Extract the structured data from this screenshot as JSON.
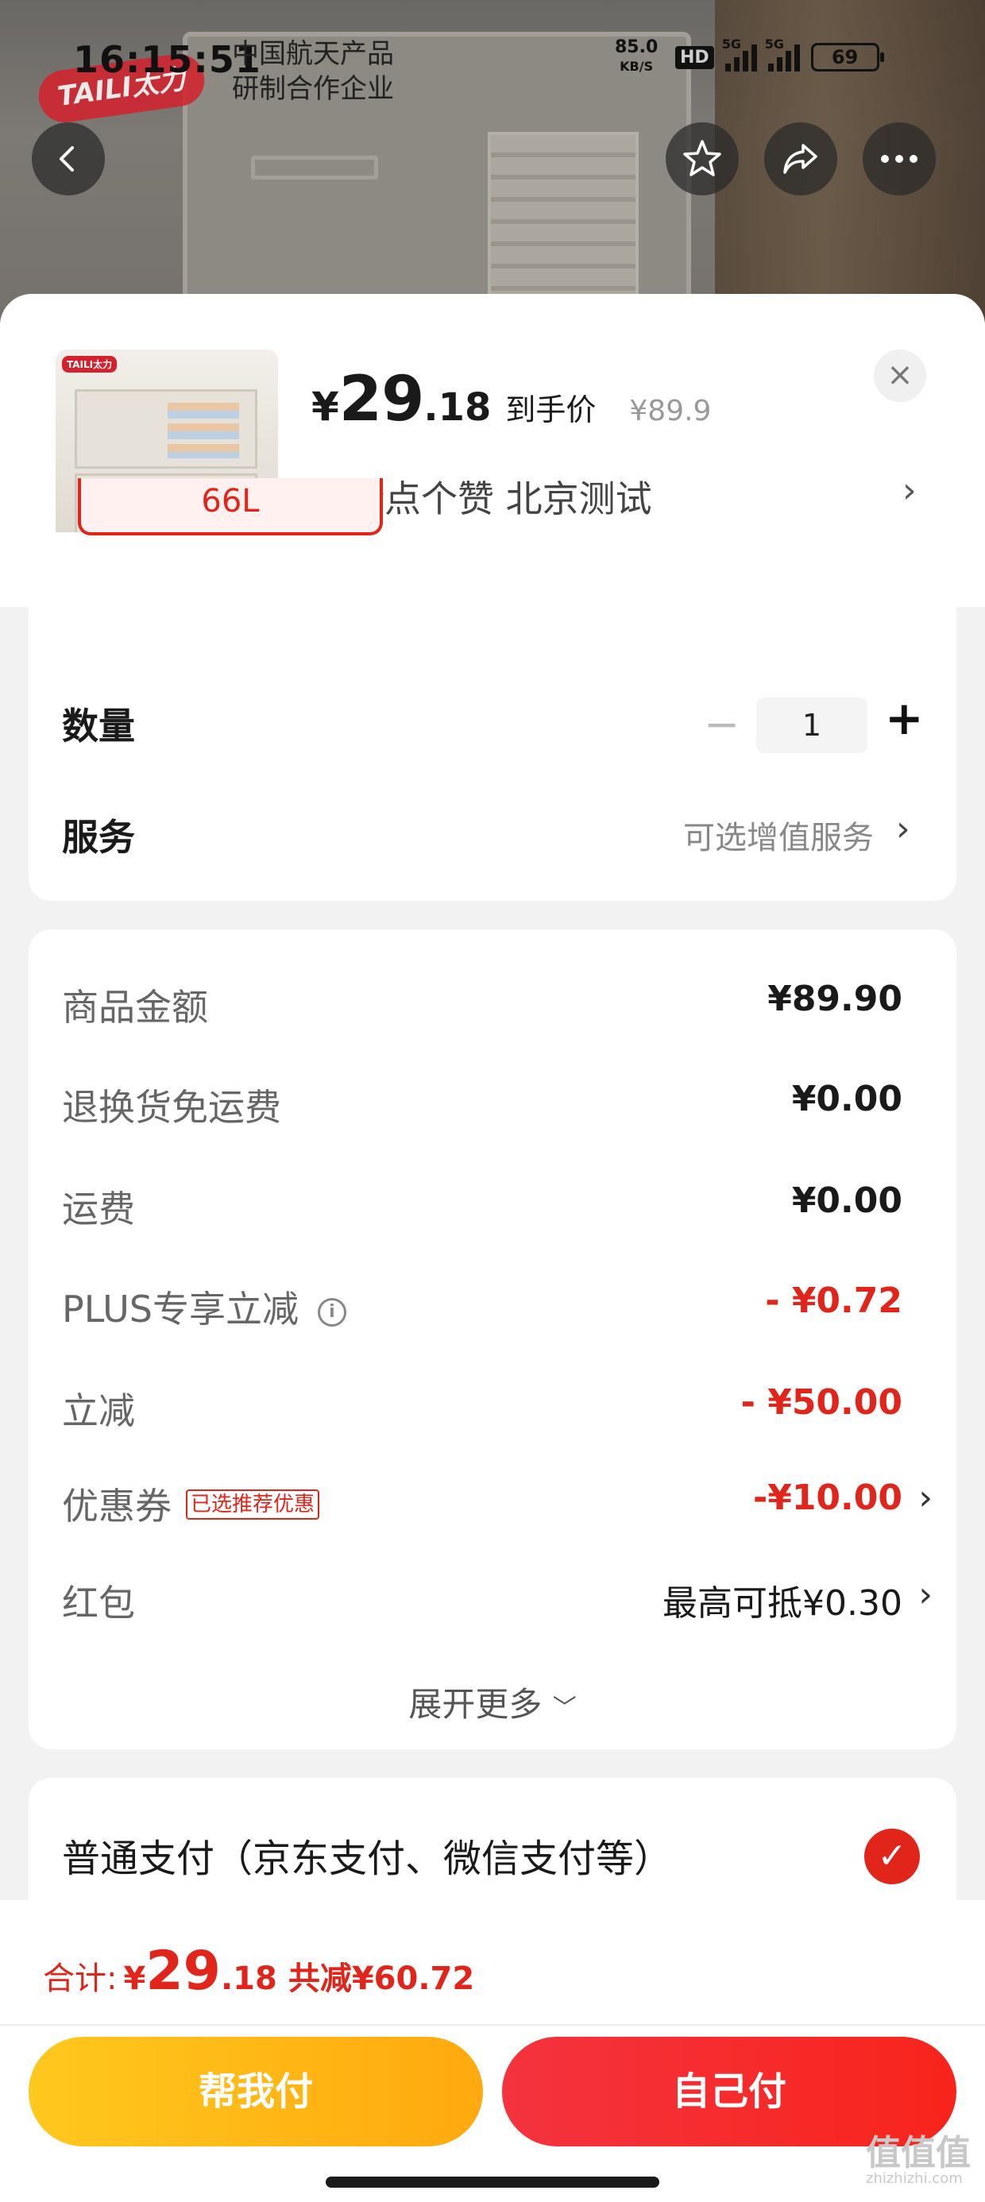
{
  "status_bar": {
    "time": "16:15:51",
    "slogan_line1": "中国航天产品",
    "slogan_line2": "研制合作企业",
    "logo_text": "TAILI太力",
    "net_speed": "85.0",
    "net_unit": "KB/S",
    "hd": "HD",
    "sig1": "5G",
    "sig2": "5G",
    "battery": "69"
  },
  "nav": {
    "back_icon": "chevron-left-icon",
    "star_icon": "star-icon",
    "share_icon": "share-icon",
    "more_icon": "more-icon"
  },
  "product": {
    "thumb_tag": "TAILI太力",
    "price_symbol": "¥",
    "price_int": "29",
    "price_dec": ".18",
    "price_label": "到手价",
    "original_price": "¥89.9",
    "spec": "评论点个赞  北京测试",
    "close": "×"
  },
  "options": {
    "selected_chip": "66L",
    "quantity_label": "数量",
    "quantity_value": "1",
    "service_label": "服务",
    "service_value": "可选增值服务"
  },
  "fees": {
    "rows": [
      {
        "label": "商品金额",
        "value": "¥89.90"
      },
      {
        "label": "退换货免运费",
        "value": "¥0.00"
      },
      {
        "label": "运费",
        "value": "¥0.00"
      },
      {
        "label": "PLUS专享立减",
        "value": "- ¥0.72"
      },
      {
        "label": "立减",
        "value": "- ¥50.00"
      },
      {
        "label": "优惠券",
        "tag": "已选推荐优惠",
        "value": "-¥10.00"
      },
      {
        "label": "红包",
        "value": "最高可抵¥0.30"
      }
    ],
    "expand": "展开更多"
  },
  "payment": {
    "method": "普通支付（京东支付、微信支付等）"
  },
  "footer": {
    "total_label": "合计:",
    "total_symbol": "¥",
    "total_int": "29",
    "total_dec": ".18",
    "discount": "共减¥60.72",
    "help_pay": "帮我付",
    "self_pay": "自己付",
    "watermark": "值值值",
    "watermark_site": "zhizhizhi.com"
  },
  "colors": {
    "accent_red": "#e1251b",
    "help_yellow": "#ffb714"
  }
}
